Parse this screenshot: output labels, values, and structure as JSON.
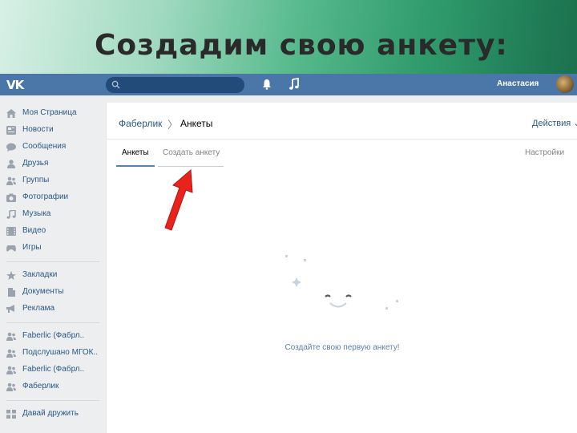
{
  "slide": {
    "title": "Создадим свою анкету:"
  },
  "header": {
    "logo": "VK",
    "search_placeholder": "",
    "user_name": "Анастасия",
    "icons": [
      "bell-icon",
      "music-icon",
      "search-icon"
    ],
    "colors": {
      "bar": "#4a76a8",
      "search": "#224b7a"
    }
  },
  "sidebar": {
    "items": [
      {
        "label": "Моя Страница",
        "icon": "home-icon"
      },
      {
        "label": "Новости",
        "icon": "news-icon"
      },
      {
        "label": "Сообщения",
        "icon": "messages-icon"
      },
      {
        "label": "Друзья",
        "icon": "friends-icon"
      },
      {
        "label": "Группы",
        "icon": "groups-icon"
      },
      {
        "label": "Фотографии",
        "icon": "camera-icon"
      },
      {
        "label": "Музыка",
        "icon": "music-note-icon"
      },
      {
        "label": "Видео",
        "icon": "video-icon"
      },
      {
        "label": "Игры",
        "icon": "gamepad-icon"
      },
      {
        "label": "Закладки",
        "icon": "star-icon"
      },
      {
        "label": "Документы",
        "icon": "document-icon"
      },
      {
        "label": "Реклама",
        "icon": "megaphone-icon"
      },
      {
        "label": "Faberlic (Фабрл..",
        "icon": "community-icon"
      },
      {
        "label": "Подслушано МГОК..",
        "icon": "community-icon"
      },
      {
        "label": "Faberlic (Фабрл..",
        "icon": "community-icon"
      },
      {
        "label": "Фаберлик",
        "icon": "community-icon"
      },
      {
        "label": "Давай дружить",
        "icon": "apps-icon"
      }
    ]
  },
  "main": {
    "breadcrumb": {
      "parent": "Фаберлик",
      "separator": "〉",
      "current": "Анкеты"
    },
    "actions_label": "Действия ⌄",
    "tabs": [
      {
        "label": "Анкеты",
        "active": true
      },
      {
        "label": "Создать анкету",
        "active": false
      }
    ],
    "settings_label": "Настройки",
    "empty_state": {
      "text": "Создайте свою первую анкету!"
    }
  },
  "annotation": {
    "arrow_color": "#e8231b"
  }
}
